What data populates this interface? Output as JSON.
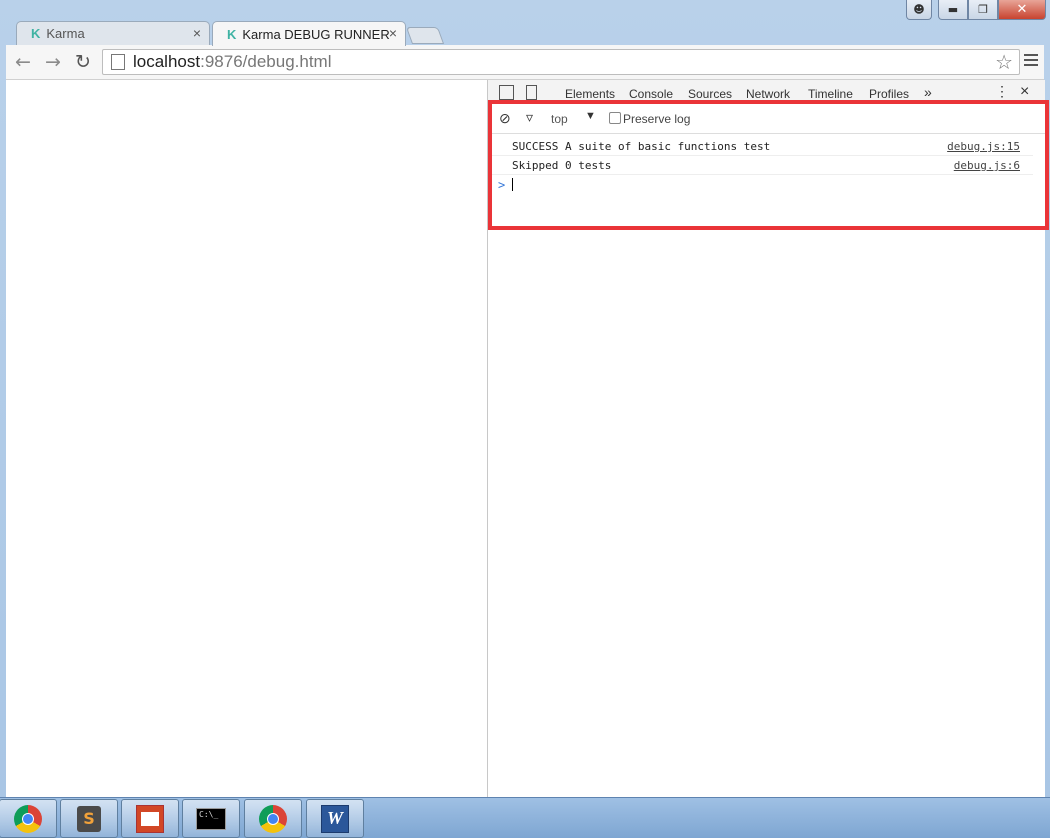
{
  "window": {
    "min_icon": "minimize-icon",
    "max_icon": "maximize-icon",
    "close_icon": "close-icon"
  },
  "tabs": [
    {
      "title": "Karma",
      "icon": "karma-icon",
      "active": false
    },
    {
      "title": "Karma DEBUG RUNNER",
      "icon": "karma-icon",
      "active": true
    }
  ],
  "tab_close_glyph": "×",
  "toolbar": {
    "url_host": "localhost",
    "url_rest": ":9876/debug.html"
  },
  "devtools": {
    "tabs": [
      "Elements",
      "Console",
      "Sources",
      "Network",
      "Timeline",
      "Profiles"
    ],
    "more_glyph": "»",
    "close_glyph": "×",
    "console": {
      "context": "top",
      "preserve_log_label": "Preserve log",
      "preserve_log_checked": false,
      "messages": [
        {
          "text": "SUCCESS A suite of basic functions test",
          "source": "debug.js:15"
        },
        {
          "text": "Skipped 0 tests",
          "source": "debug.js:6"
        }
      ],
      "prompt_glyph": ">"
    }
  },
  "highlight_color": "#ea3438",
  "taskbar": {
    "items": [
      "chrome-icon",
      "sublime-text-icon",
      "powerpoint-icon",
      "cmd-icon",
      "chrome-icon",
      "word-icon"
    ],
    "cmd_text": "C:\\_"
  }
}
